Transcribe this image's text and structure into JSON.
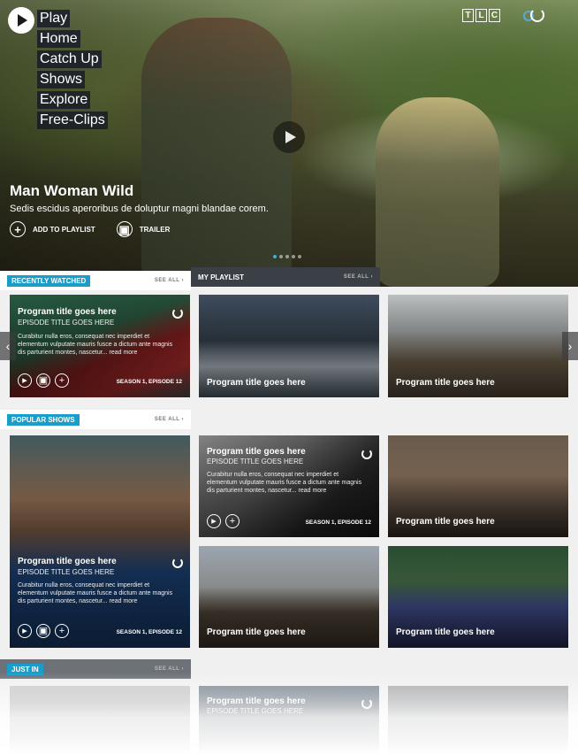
{
  "nav": {
    "logo_label": "Play",
    "items": [
      "Home",
      "Catch Up",
      "Shows",
      "Explore",
      "Free-Clips"
    ]
  },
  "brand": {
    "letters": [
      "T",
      "L",
      "C"
    ]
  },
  "hero": {
    "title": "Man Woman Wild",
    "description": "Sedis escidus aperoribus de doluptur magni blandae corem.",
    "add_to_playlist": "ADD TO PLAYLIST",
    "trailer": "TRAILER"
  },
  "sections": {
    "recently_watched": "RECENTLY WATCHED",
    "my_playlist": "MY PLAYLIST",
    "popular_shows": "POPULAR SHOWS",
    "just_in": "JUST IN",
    "see_all": "SEE ALL"
  },
  "cards": {
    "program_title": "Program title goes here",
    "episode_title": "EPISODE TITLE GOES HERE",
    "description": "Curabitur nulla eros, consequat nec imperdiet et elementum vulputate mauris fusce a dictum ante magnis dis parturient montes, nascetur... read more",
    "season": "SEASON 1, EPISODE 12"
  },
  "colors": {
    "accent": "#1a9dc9",
    "dark_header": "#3b4047"
  }
}
